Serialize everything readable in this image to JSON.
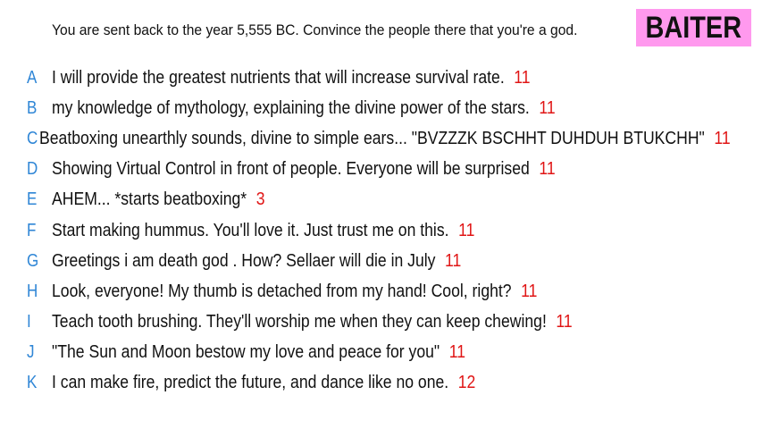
{
  "prompt": "You are sent back to the year 5,555 BC. Convince the people there that you're a god.",
  "badge": "BAITER",
  "colors": {
    "letter": "#2f86d6",
    "score": "#e01515",
    "badge_bg": "#ff99ee"
  },
  "answers": [
    {
      "letter": "A",
      "text": "I will provide the greatest nutrients that will increase survival rate.",
      "score": "11"
    },
    {
      "letter": "B",
      "text": "my knowledge of mythology, explaining the divine power of the stars.",
      "score": "11"
    },
    {
      "letter": "C",
      "text": "Beatboxing unearthly sounds, divine to simple ears... \"BVZZZK BSCHHT DUHDUH BTUKCHH\"",
      "score": "11"
    },
    {
      "letter": "D",
      "text": "Showing Virtual Control in front of people. Everyone will be surprised",
      "score": "11"
    },
    {
      "letter": "E",
      "text": "AHEM... *starts beatboxing*",
      "score": "3"
    },
    {
      "letter": "F",
      "text": "Start making hummus. You'll love it. Just trust me on this.",
      "score": "11"
    },
    {
      "letter": "G",
      "text": "Greetings i am death god . How? Sellaer will die in July",
      "score": "11"
    },
    {
      "letter": "H",
      "text": "Look, everyone! My thumb is detached from my hand! Cool, right?",
      "score": "11"
    },
    {
      "letter": "I",
      "text": "Teach tooth brushing. They'll worship me when they can keep chewing!",
      "score": "11"
    },
    {
      "letter": "J",
      "text": "\"The Sun and Moon bestow my love and peace for you\"",
      "score": "11"
    },
    {
      "letter": "K",
      "text": "I can make fire, predict the future, and dance like no one.",
      "score": "12"
    }
  ]
}
